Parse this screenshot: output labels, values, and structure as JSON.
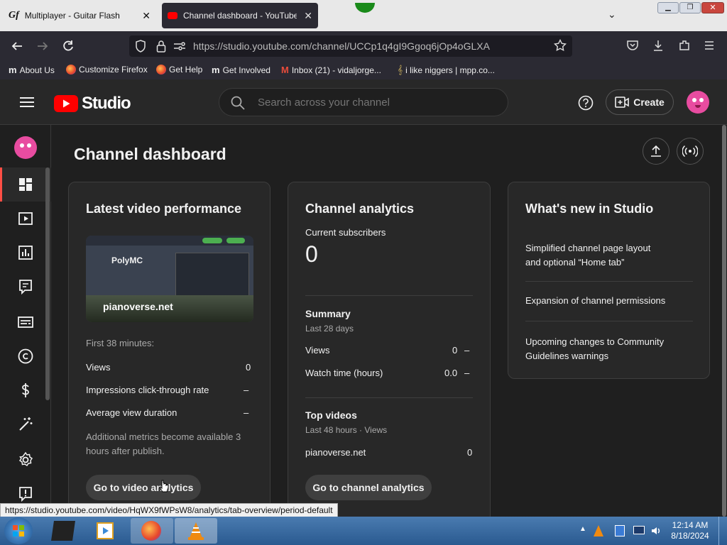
{
  "browser": {
    "tabs": [
      {
        "title": "Multiplayer - Guitar Flash",
        "icon": "guitar-flash-icon"
      },
      {
        "title": "Channel dashboard - YouTube",
        "icon": "youtube-icon"
      }
    ],
    "url": "https://studio.youtube.com/channel/UCCp1q4gI9Ggoq6jOp4oGLXA",
    "bookmarks": [
      {
        "label": "About Us",
        "icon": "mozilla-icon"
      },
      {
        "label": "Customize Firefox",
        "icon": "firefox-icon"
      },
      {
        "label": "Get Help",
        "icon": "firefox-icon"
      },
      {
        "label": "Get Involved",
        "icon": "mozilla-icon"
      },
      {
        "label": "Inbox (21) - vidaljorge...",
        "icon": "gmail-icon"
      },
      {
        "label": "i like niggers | mpp.co...",
        "icon": "music-note-icon"
      }
    ],
    "status_url": "https://studio.youtube.com/video/HqWX9fWPsW8/analytics/tab-overview/period-default"
  },
  "studio": {
    "logo_text": "Studio",
    "search_placeholder": "Search across your channel",
    "create_label": "Create",
    "page_title": "Channel dashboard",
    "latest": {
      "title": "Latest video performance",
      "thumb_title": "PolyMC",
      "thumb_caption": "pianoverse.net",
      "first_minutes": "First 38 minutes:",
      "metrics": [
        {
          "label": "Views",
          "value": "0"
        },
        {
          "label": "Impressions click-through rate",
          "value": "–"
        },
        {
          "label": "Average view duration",
          "value": "–"
        }
      ],
      "note": "Additional metrics become available 3 hours after publish.",
      "button": "Go to video analytics"
    },
    "analytics": {
      "title": "Channel analytics",
      "subs_label": "Current subscribers",
      "subs_value": "0",
      "summary_title": "Summary",
      "summary_period": "Last 28 days",
      "summary_rows": [
        {
          "label": "Views",
          "value": "0",
          "trend": "–"
        },
        {
          "label": "Watch time (hours)",
          "value": "0.0",
          "trend": "–"
        }
      ],
      "top_title": "Top videos",
      "top_period": "Last 48 hours · Views",
      "top_rows": [
        {
          "label": "pianoverse.net",
          "value": "0"
        }
      ],
      "button": "Go to channel analytics"
    },
    "whatsnew": {
      "title": "What's new in Studio",
      "items": [
        "Simplified channel page layout and optional “Home tab”",
        "Expansion of channel permissions",
        "Upcoming changes to Community Guidelines warnings"
      ]
    }
  },
  "taskbar": {
    "time": "12:14 AM",
    "date": "8/18/2024"
  },
  "colors": {
    "youtube_red": "#ff0000",
    "bg_dark": "#1f1f1f",
    "card": "#282828"
  }
}
